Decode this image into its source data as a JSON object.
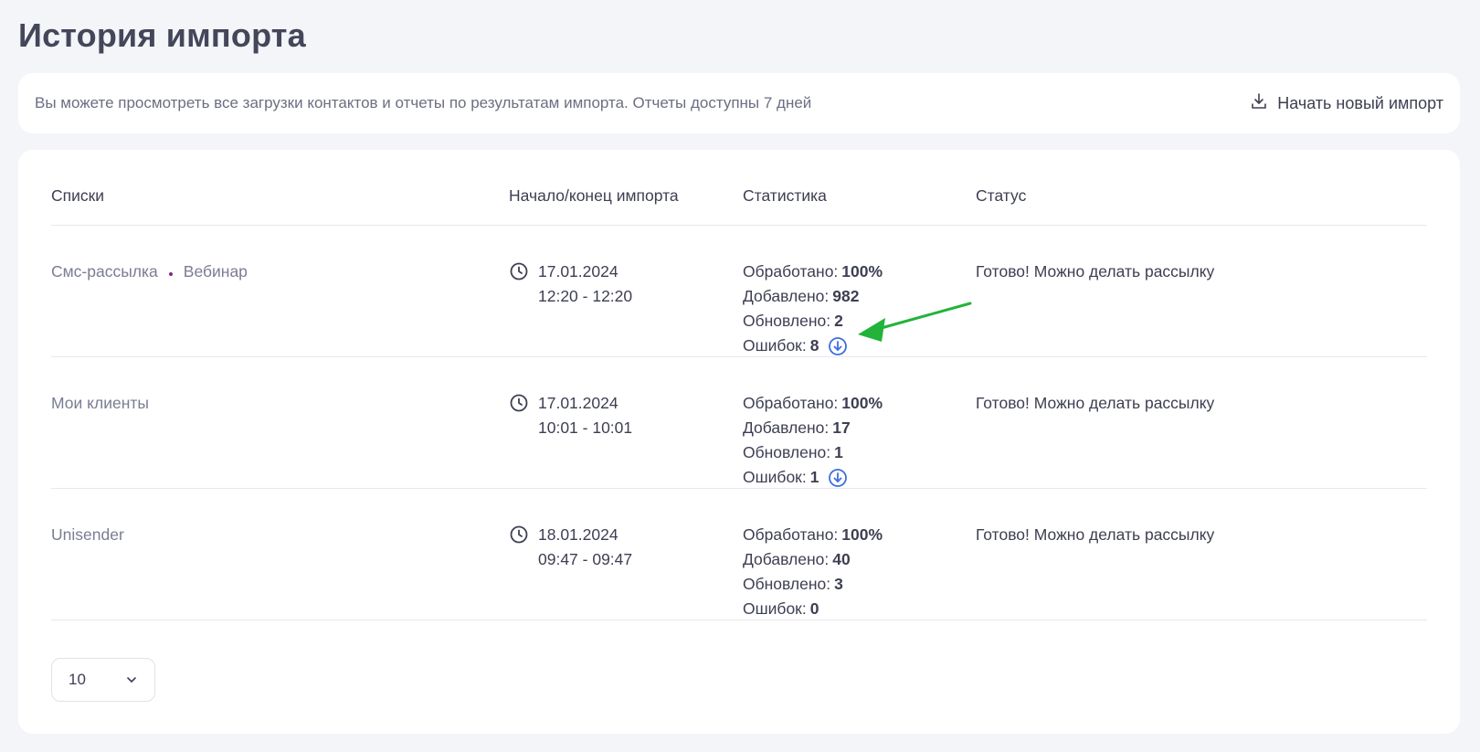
{
  "page": {
    "title": "История импорта"
  },
  "info": {
    "text": "Вы можете просмотреть все загрузки контактов и отчеты по результатам импорта. Отчеты доступны 7 дней",
    "new_import_label": "Начать новый импорт",
    "new_import_icon": "download-tray-icon"
  },
  "table": {
    "headers": [
      "Списки",
      "Начало/конец импорта",
      "Статистика",
      "Статус"
    ],
    "rows": [
      {
        "lists": [
          "Смс-рассылка",
          "Вебинар"
        ],
        "date": "17.01.2024",
        "time": "12:20 - 12:20",
        "processed_label": "Обработано:",
        "processed": "100%",
        "added_label": "Добавлено:",
        "added": "982",
        "updated_label": "Обновлено:",
        "updated": "2",
        "errors_label": "Ошибок:",
        "errors": "8",
        "has_error_download": true,
        "status": "Готово! Можно делать рассылку"
      },
      {
        "lists": [
          "Мои клиенты"
        ],
        "date": "17.01.2024",
        "time": "10:01 - 10:01",
        "processed_label": "Обработано:",
        "processed": "100%",
        "added_label": "Добавлено:",
        "added": "17",
        "updated_label": "Обновлено:",
        "updated": "1",
        "errors_label": "Ошибок:",
        "errors": "1",
        "has_error_download": true,
        "status": "Готово! Можно делать рассылку"
      },
      {
        "lists": [
          "Unisender"
        ],
        "date": "18.01.2024",
        "time": "09:47 - 09:47",
        "processed_label": "Обработано:",
        "processed": "100%",
        "added_label": "Добавлено:",
        "added": "40",
        "updated_label": "Обновлено:",
        "updated": "3",
        "errors_label": "Ошибок:",
        "errors": "0",
        "has_error_download": false,
        "status": "Готово! Можно делать рассылку"
      }
    ]
  },
  "pagination": {
    "page_size": "10"
  },
  "colors": {
    "accent_blue": "#3b6fe0",
    "list_dot": "#7b2d7a",
    "annotation_arrow": "#22b33a"
  }
}
